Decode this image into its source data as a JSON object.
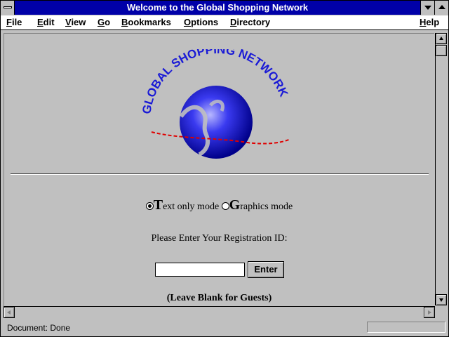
{
  "window": {
    "title": "Welcome to the Global Shopping Network"
  },
  "menu": {
    "items": [
      {
        "label": "File",
        "hotkey": "F",
        "rest": "ile"
      },
      {
        "label": "Edit",
        "hotkey": "E",
        "rest": "dit"
      },
      {
        "label": "View",
        "hotkey": "V",
        "rest": "iew"
      },
      {
        "label": "Go",
        "hotkey": "G",
        "rest": "o"
      },
      {
        "label": "Bookmarks",
        "hotkey": "B",
        "rest": "ookmarks"
      },
      {
        "label": "Options",
        "hotkey": "O",
        "rest": "ptions"
      },
      {
        "label": "Directory",
        "hotkey": "D",
        "rest": "irectory"
      },
      {
        "label": "Help",
        "hotkey": "H",
        "rest": "elp"
      }
    ]
  },
  "logo": {
    "text": "GLOBAL SHOPPING NETWORK",
    "globe_color": "#1a1ad6",
    "swoosh_color": "#e00000"
  },
  "mode": {
    "text_only": {
      "initial": "T",
      "rest": "ext only mode",
      "selected": true
    },
    "graphics": {
      "initial": "G",
      "rest": "raphics mode",
      "selected": false
    }
  },
  "registration": {
    "prompt": "Please Enter Your Registration ID:",
    "input_value": "",
    "enter_label": "Enter",
    "note": "(Leave Blank for Guests)"
  },
  "status": {
    "text": "Document: Done"
  }
}
